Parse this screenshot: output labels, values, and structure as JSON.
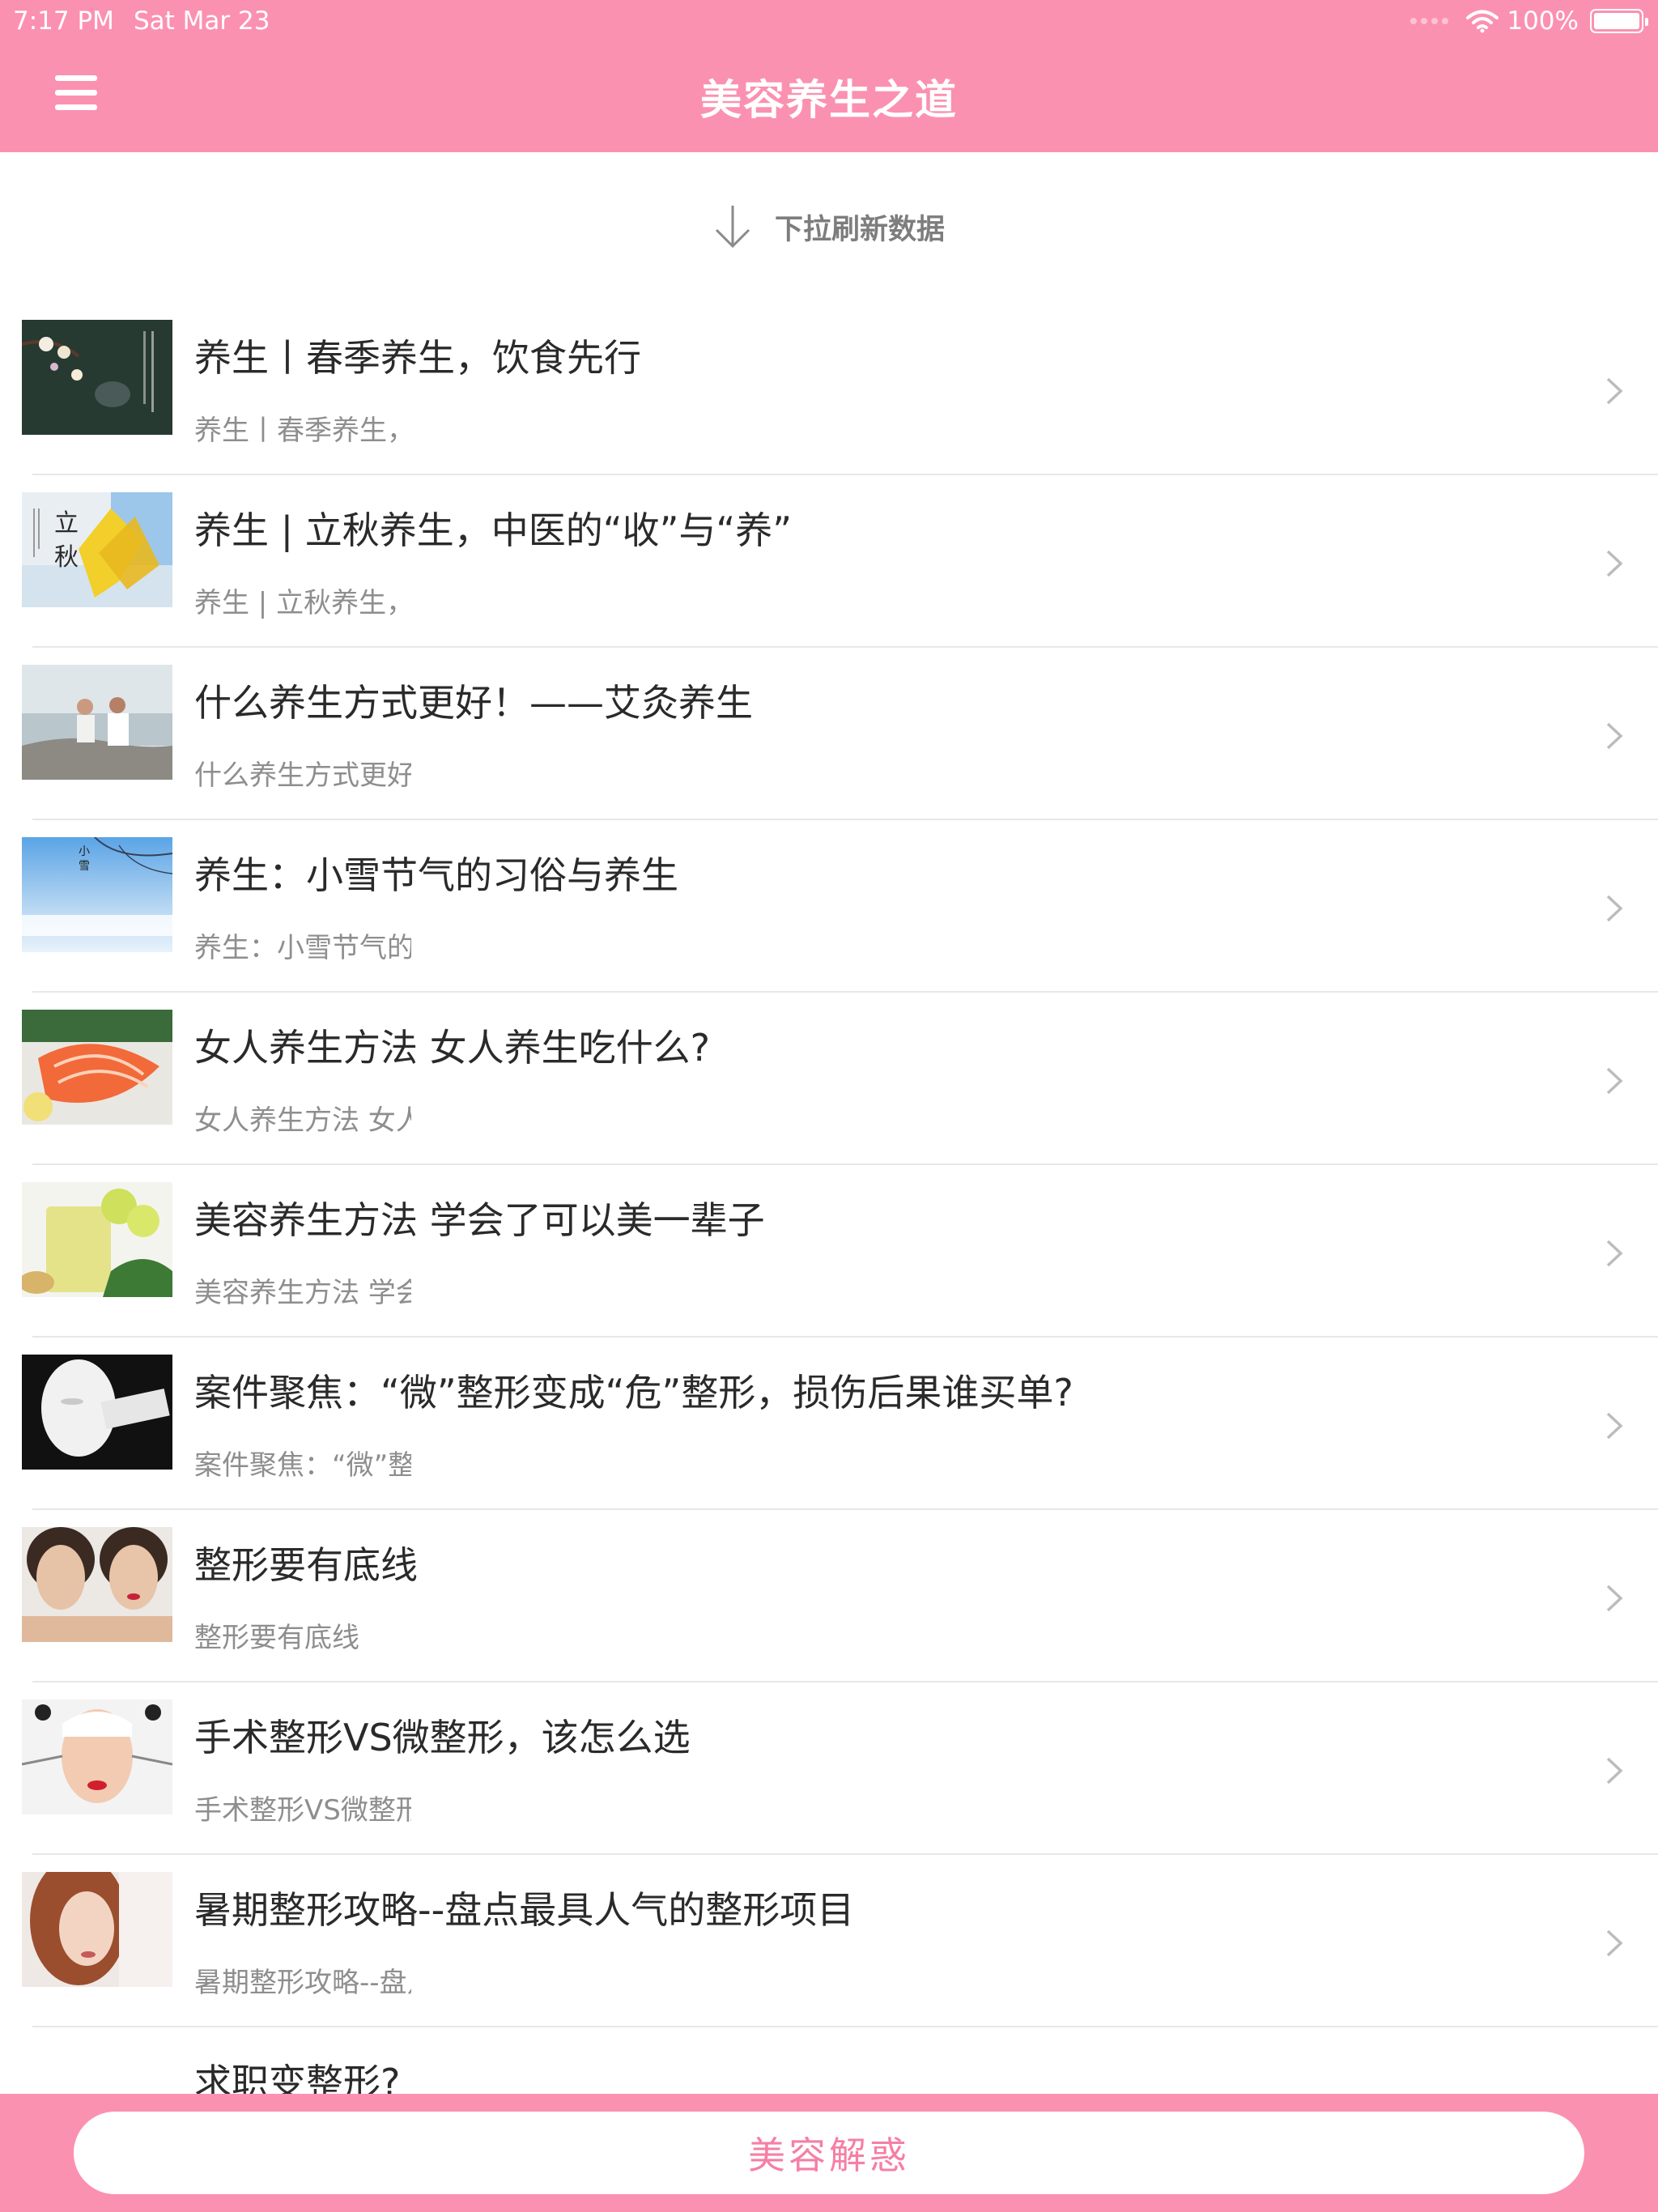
{
  "status_bar": {
    "time": "7:17 PM",
    "date": "Sat Mar 23",
    "battery": "100%",
    "wifi_icon": "wifi-icon",
    "battery_icon": "battery-icon"
  },
  "header": {
    "title": "美容养生之道",
    "menu_icon": "hamburger-menu-icon",
    "background": "#fb91b0"
  },
  "refresh": {
    "label": "下拉刷新数据",
    "icon": "arrow-down-icon"
  },
  "list": [
    {
      "title": "养生丨春季养生，饮食先行",
      "subtitle": "养生丨春季养生，"
    },
    {
      "title": "养生 | 立秋养生，中医的“收”与“养”",
      "subtitle": "养生 | 立秋养生，"
    },
    {
      "title": "什么养生方式更好！——艾灸养生",
      "subtitle": "什么养生方式更好"
    },
    {
      "title": "养生：小雪节气的习俗与养生",
      "subtitle": "养生：小雪节气的"
    },
    {
      "title": "女人养生方法 女人养生吃什么?",
      "subtitle": "女人养生方法 女人"
    },
    {
      "title": "美容养生方法 学会了可以美一辈子",
      "subtitle": "美容养生方法 学会"
    },
    {
      "title": "案件聚焦：“微”整形变成“危”整形，损伤后果谁买单?",
      "subtitle": "案件聚焦：“微”整"
    },
    {
      "title": "整形要有底线",
      "subtitle": "整形要有底线"
    },
    {
      "title": "手术整形VS微整形，该怎么选",
      "subtitle": "手术整形VS微整形"
    },
    {
      "title": "暑期整形攻略--盘点最具人气的整形项目",
      "subtitle": "暑期整形攻略--盘点"
    },
    {
      "title": "求职变整形?",
      "subtitle": ""
    }
  ],
  "bottom": {
    "button_label": "美容解惑",
    "accent": "#f57fa5"
  }
}
